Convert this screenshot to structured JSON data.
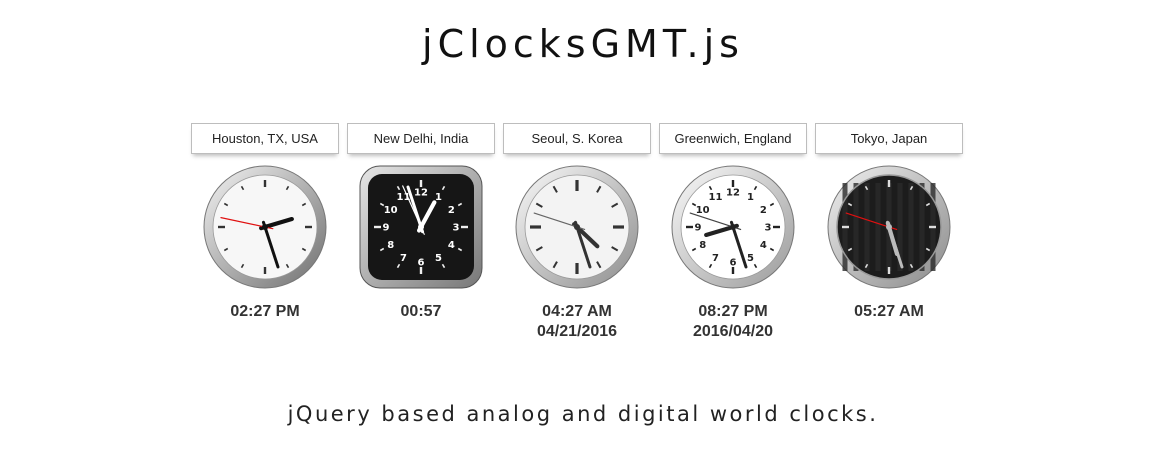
{
  "page": {
    "title": "jClocksGMT.js",
    "subtitle": "jQuery based analog and digital world clocks."
  },
  "clocks": [
    {
      "location": "Houston, TX, USA",
      "time": "02:27 PM",
      "date": "",
      "skin": "silver-ring",
      "hands": {
        "hour": 14,
        "minute": 27,
        "second": 47
      },
      "second_hand_color": "#e01010"
    },
    {
      "location": "New Delhi, India",
      "time": "00:57",
      "date": "",
      "skin": "black-square",
      "hands": {
        "hour": 0,
        "minute": 57,
        "second": 56
      },
      "second_hand_color": "#ffffff"
    },
    {
      "location": "Seoul, S. Korea",
      "time": "04:27 AM",
      "date": "04/21/2016",
      "skin": "glass-white",
      "hands": {
        "hour": 4,
        "minute": 27,
        "second": 48
      },
      "second_hand_color": "#666666"
    },
    {
      "location": "Greenwich, England",
      "time": "08:27 PM",
      "date": "2016/04/20",
      "skin": "white-numbers",
      "hands": {
        "hour": 20,
        "minute": 27,
        "second": 48
      },
      "second_hand_color": "#444444"
    },
    {
      "location": "Tokyo, Japan",
      "time": "05:27 AM",
      "date": "",
      "skin": "black-round",
      "hands": {
        "hour": 5,
        "minute": 27,
        "second": 48
      },
      "second_hand_color": "#e01010"
    }
  ]
}
